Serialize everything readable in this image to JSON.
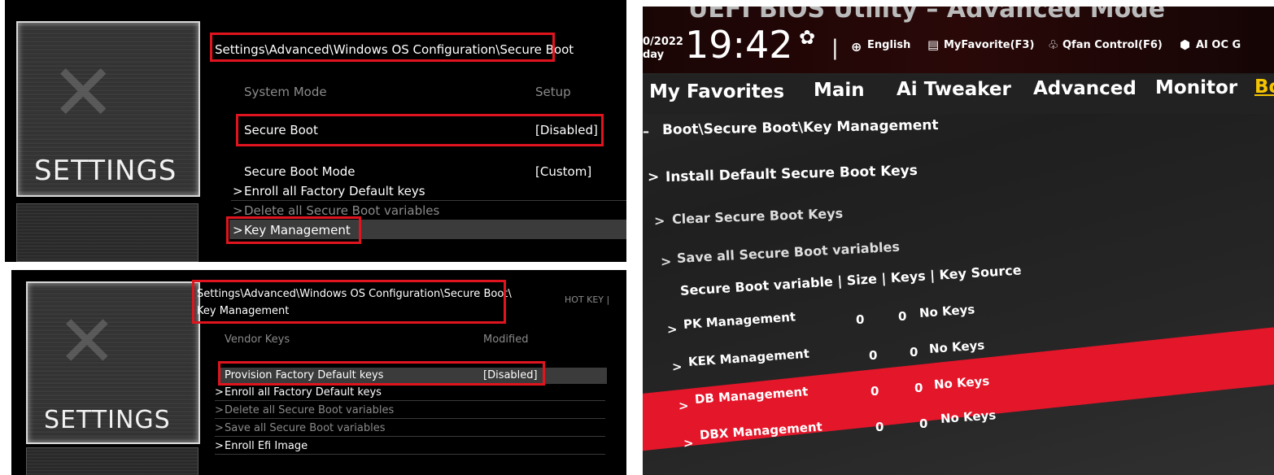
{
  "msi_top": {
    "side_label": "SETTINGS",
    "breadcrumb": "Settings\\Advanced\\Windows OS Configuration\\Secure Boot",
    "items": [
      {
        "label": "System Mode",
        "value": "Setup"
      },
      {
        "label": "Secure Boot",
        "value": "[Disabled]"
      },
      {
        "label": "Secure Boot Mode",
        "value": "[Custom]"
      },
      {
        "label": "Enroll all Factory Default keys",
        "value": ""
      },
      {
        "label": "Delete all Secure Boot variables",
        "value": ""
      },
      {
        "label": "Key Management",
        "value": ""
      }
    ]
  },
  "msi_bottom": {
    "side_label": "SETTINGS",
    "breadcrumb_line1": "Settings\\Advanced\\Windows OS Configuration\\Secure Boot\\",
    "breadcrumb_line2": "Key Management",
    "hotkey": "HOT KEY | ",
    "items": [
      {
        "label": "Vendor Keys",
        "value": "Modified"
      },
      {
        "label": "Provision Factory Default keys",
        "value": "[Disabled]"
      },
      {
        "label": "Enroll all Factory Default keys",
        "value": ""
      },
      {
        "label": "Delete all Secure Boot variables",
        "value": ""
      },
      {
        "label": "Save all Secure Boot variables",
        "value": ""
      },
      {
        "label": "Enroll Efi Image",
        "value": ""
      }
    ]
  },
  "asus": {
    "title": "UEFI BIOS Utility – Advanced Mode",
    "date": "0/2022",
    "day": "day",
    "time": "19:42",
    "toolbar": {
      "language": "English",
      "favorite": "MyFavorite(F3)",
      "qfan": "Qfan Control(F6)",
      "ai": "AI OC G"
    },
    "tabs": [
      "My Favorites",
      "Main",
      "Ai Tweaker",
      "Advanced",
      "Monitor",
      "Bo"
    ],
    "breadcrumb": "Boot\\Secure Boot\\Key Management",
    "items": [
      {
        "label": "Install Default Secure Boot Keys"
      },
      {
        "label": "Clear Secure Boot Keys"
      },
      {
        "label": "Save all Secure Boot variables"
      }
    ],
    "table_header": "Secure Boot variable | Size | Keys | Key Source",
    "table_rows": [
      {
        "name": "PK Management",
        "size": "0",
        "keys": "0",
        "source": "No Keys"
      },
      {
        "name": "KEK Management",
        "size": "0",
        "keys": "0",
        "source": "No Keys"
      },
      {
        "name": "DB Management",
        "size": "0",
        "keys": "0",
        "source": "No Keys"
      },
      {
        "name": "DBX Management",
        "size": "0",
        "keys": "0",
        "source": "No Keys"
      }
    ],
    "colors": {
      "highlight": "#e4162a",
      "tab_accent": "#f5c400"
    }
  },
  "colors": {
    "annotation": "#e0141e"
  }
}
